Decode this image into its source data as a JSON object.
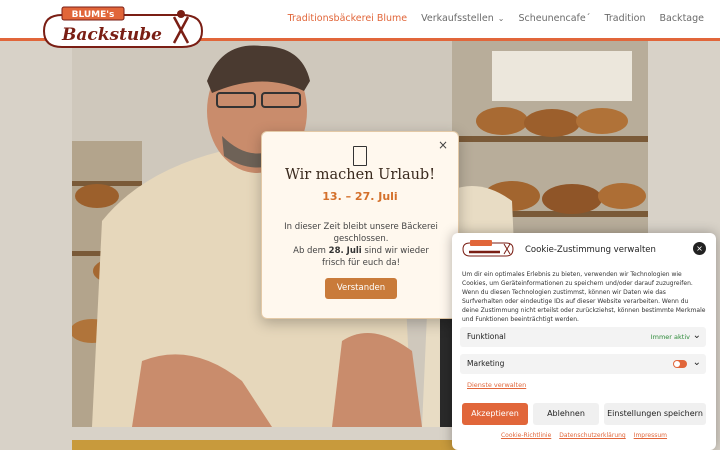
{
  "brand": {
    "logo_top": "BLUME's",
    "logo_main": "Backstube"
  },
  "nav": {
    "items": [
      {
        "label": "Traditionsbäckerei Blume",
        "active": true
      },
      {
        "label": "Verkaufsstellen",
        "has_dropdown": true
      },
      {
        "label": "Scheunencafe´"
      },
      {
        "label": "Tradition"
      },
      {
        "label": "Backtage"
      }
    ]
  },
  "vacation_modal": {
    "title": "Wir machen Urlaub!",
    "dates": "13. – 27. Juli",
    "line1": "In dieser Zeit bleibt unsere Bäckerei geschlossen.",
    "line2_prefix": "Ab dem ",
    "line2_bold": "28. Juli",
    "line2_suffix": " sind wir wieder frisch für euch da!",
    "button": "Verstanden",
    "close_symbol": "×"
  },
  "cookie_panel": {
    "title": "Cookie-Zustimmung verwalten",
    "close_symbol": "×",
    "text": "Um dir ein optimales Erlebnis zu bieten, verwenden wir Technologien wie Cookies, um Geräteinformationen zu speichern und/oder darauf zuzugreifen. Wenn du diesen Technologien zustimmst, können wir Daten wie das Surfverhalten oder eindeutige IDs auf dieser Website verarbeiten. Wenn du deine Zustimmung nicht erteilst oder zurückziehst, können bestimmte Merkmale und Funktionen beeinträchtigt werden.",
    "categories": [
      {
        "label": "Funktional",
        "status": "Immer aktiv"
      },
      {
        "label": "Marketing",
        "toggle_on": true
      }
    ],
    "services_link": "Dienste verwalten",
    "buttons": {
      "accept": "Akzeptieren",
      "deny": "Ablehnen",
      "preferences": "Einstellungen speichern"
    },
    "footer_links": [
      "Cookie-Richtlinie",
      "Datenschutzerklärung",
      "Impressum"
    ]
  },
  "colors": {
    "accent": "#e1663a",
    "modal_button": "#c97b3a",
    "active_status": "#2e8b3a"
  }
}
